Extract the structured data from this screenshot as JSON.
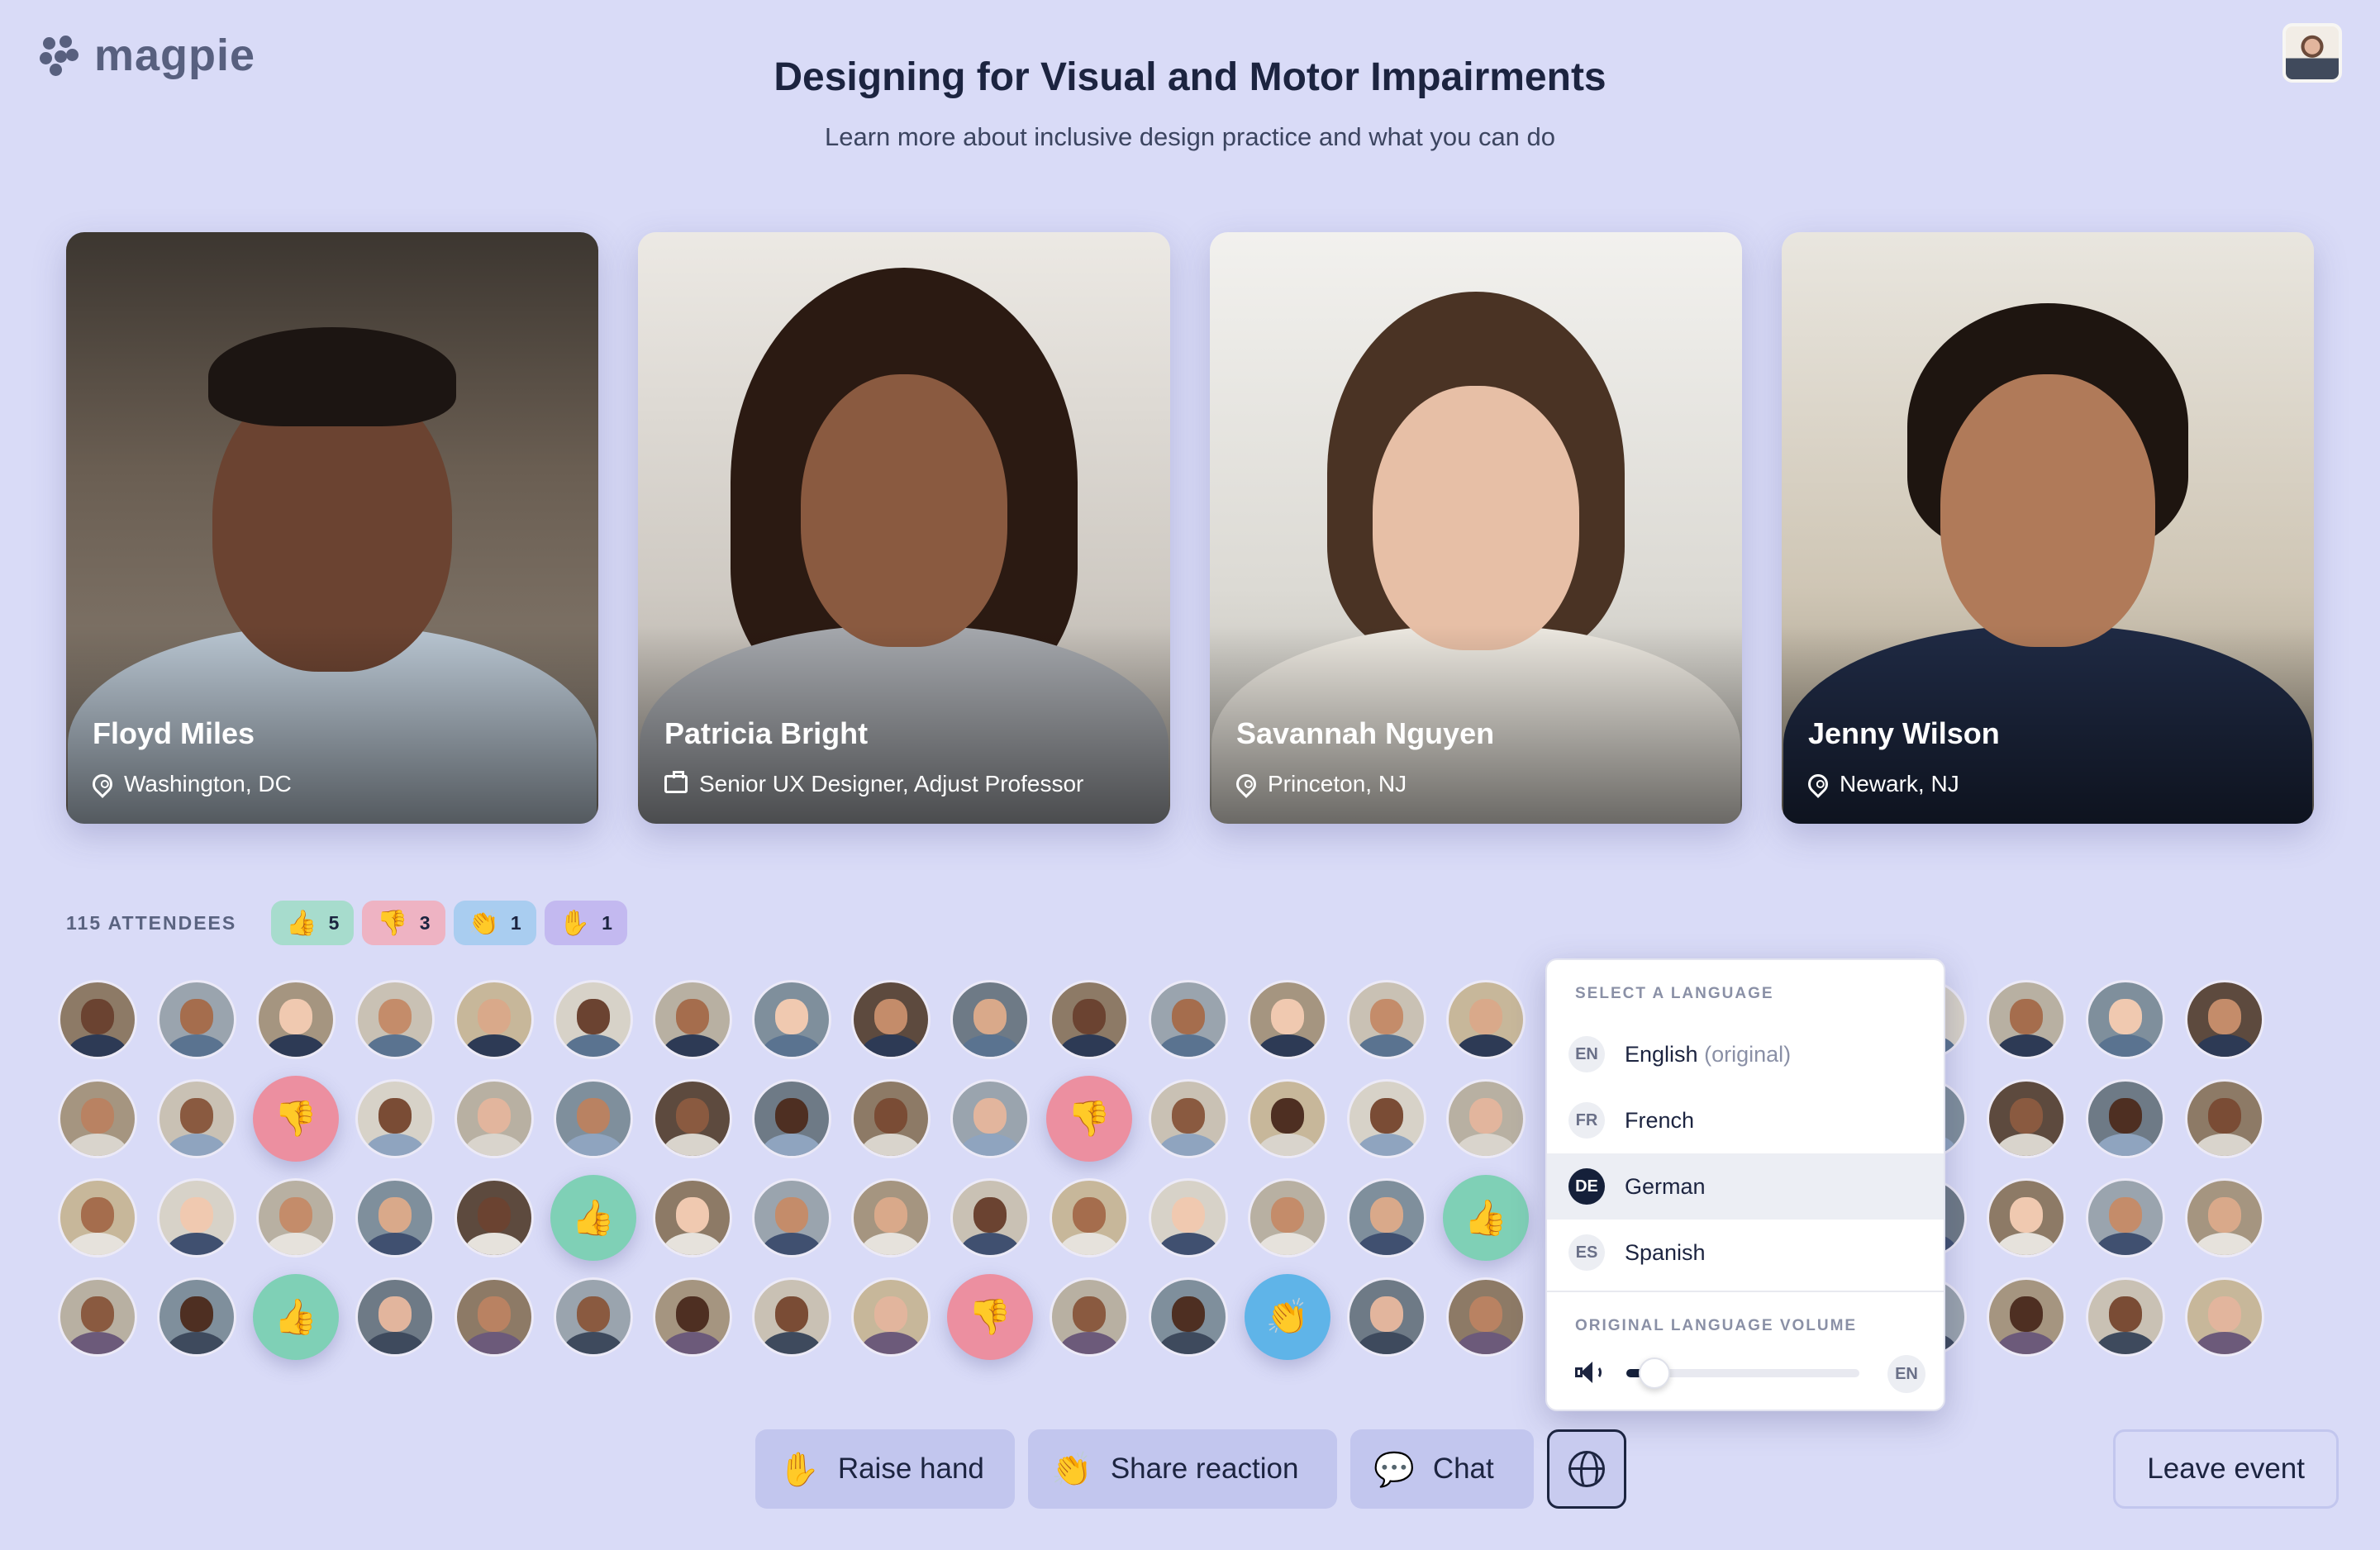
{
  "app": {
    "name": "magpie"
  },
  "event": {
    "title": "Designing for Visual and Motor Impairments",
    "subtitle": "Learn more about inclusive design practice and what you can do"
  },
  "speakers": [
    {
      "name": "Floyd Miles",
      "meta": "Washington, DC",
      "meta_icon": "location-pin-icon"
    },
    {
      "name": "Patricia Bright",
      "meta": "Senior UX Designer, Adjust Professor",
      "meta_icon": "briefcase-icon"
    },
    {
      "name": "Savannah Nguyen",
      "meta": "Princeton, NJ",
      "meta_icon": "location-pin-icon"
    },
    {
      "name": "Jenny Wilson",
      "meta": "Newark, NJ",
      "meta_icon": "location-pin-icon"
    }
  ],
  "attendees": {
    "label": "115 ATTENDEES",
    "reactions": [
      {
        "emoji": "👍",
        "count": "5",
        "color": "#a7dccd",
        "icon": "thumbs-up-icon"
      },
      {
        "emoji": "👎",
        "count": "3",
        "color": "#eeb3c3",
        "icon": "thumbs-down-icon"
      },
      {
        "emoji": "👏",
        "count": "1",
        "color": "#a9cdf0",
        "icon": "clapping-hands-icon"
      },
      {
        "emoji": "✋",
        "count": "1",
        "color": "#c3b9f0",
        "icon": "raised-hand-icon"
      }
    ]
  },
  "language_panel": {
    "heading": "SELECT A LANGUAGE",
    "options": [
      {
        "code": "EN",
        "label": "English",
        "note": "(original)"
      },
      {
        "code": "FR",
        "label": "French",
        "note": ""
      },
      {
        "code": "DE",
        "label": "German",
        "note": ""
      },
      {
        "code": "ES",
        "label": "Spanish",
        "note": ""
      }
    ],
    "selected": "DE",
    "volume_heading": "ORIGINAL LANGUAGE VOLUME",
    "volume_level": 0.12,
    "volume_language": "EN"
  },
  "toolbar": {
    "raise_hand": {
      "emoji": "✋",
      "label": "Raise hand"
    },
    "share_reaction": {
      "emoji": "👏",
      "label": "Share reaction"
    },
    "chat": {
      "emoji": "💬",
      "label": "Chat"
    },
    "language_icon": "globe-icon",
    "leave": "Leave event"
  },
  "colors": {
    "background": "#d9dbf7",
    "button": "#c2c6ee",
    "accent": "#15203a",
    "thumbs_up": "#7fd0b6",
    "thumbs_down": "#ec8fa0",
    "clap": "#5fb4e8"
  }
}
